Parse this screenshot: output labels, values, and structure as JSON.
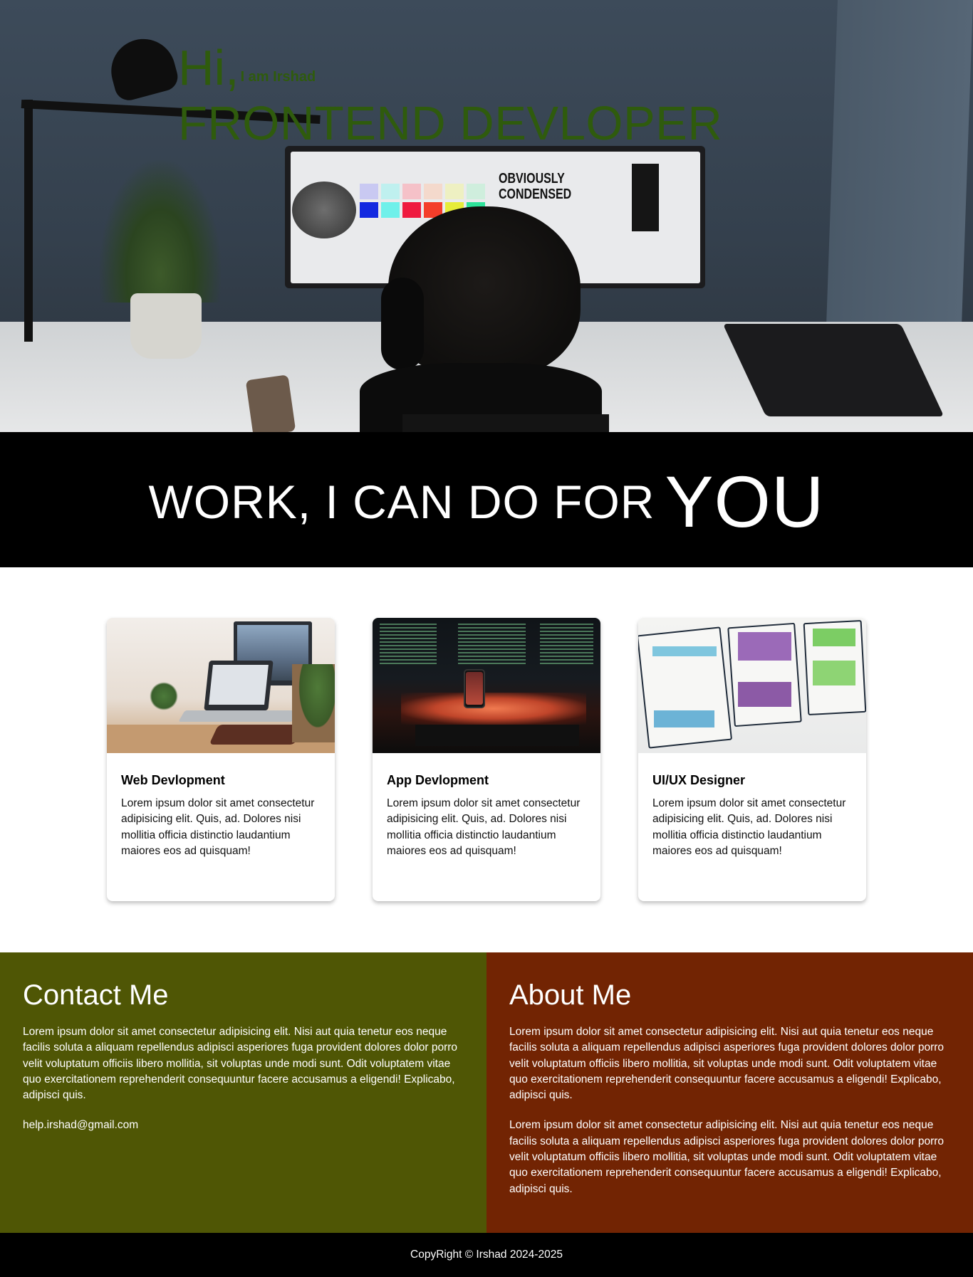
{
  "hero": {
    "greeting": "Hi,",
    "name": "I am Irshad",
    "role": "FRONTEND DEVLOPER",
    "text_color": "#2f5b0d",
    "screen_text_line1": "OBVIOUSLY",
    "screen_text_line2": "CONDENSED"
  },
  "banner": {
    "text": "WORK, I CAN DO FOR",
    "emphasis": "YOU",
    "background": "#000000"
  },
  "services": [
    {
      "title": "Web Devlopment",
      "text": "Lorem ipsum dolor sit amet consectetur adipisicing elit. Quis, ad. Dolores nisi mollitia officia distinctio laudantium maiores eos ad quisquam!",
      "image": "workspace-laptop-photo"
    },
    {
      "title": "App Devlopment",
      "text": "Lorem ipsum dolor sit amet consectetur adipisicing elit. Quis, ad. Dolores nisi mollitia officia distinctio laudantium maiores eos ad quisquam!",
      "image": "code-monitors-phone-photo"
    },
    {
      "title": "UI/UX Designer",
      "text": "Lorem ipsum dolor sit amet consectetur adipisicing elit. Quis, ad. Dolores nisi mollitia officia distinctio laudantium maiores eos ad quisquam!",
      "image": "wireframe-sketch-photo"
    }
  ],
  "contact": {
    "title": "Contact Me",
    "text": "Lorem ipsum dolor sit amet consectetur adipisicing elit. Nisi aut quia tenetur eos neque facilis soluta a aliquam repellendus adipisci asperiores fuga provident dolores dolor porro velit voluptatum officiis libero mollitia, sit voluptas unde modi sunt. Odit voluptatem vitae quo exercitationem reprehenderit consequuntur facere accusamus a eligendi! Explicabo, adipisci quis.",
    "email": "help.irshad@gmail.com",
    "background": "#4f5605"
  },
  "about": {
    "title": "About Me",
    "paragraphs": [
      "Lorem ipsum dolor sit amet consectetur adipisicing elit. Nisi aut quia tenetur eos neque facilis soluta a aliquam repellendus adipisci asperiores fuga provident dolores dolor porro velit voluptatum officiis libero mollitia, sit voluptas unde modi sunt. Odit voluptatem vitae quo exercitationem reprehenderit consequuntur facere accusamus a eligendi! Explicabo, adipisci quis.",
      "Lorem ipsum dolor sit amet consectetur adipisicing elit. Nisi aut quia tenetur eos neque facilis soluta a aliquam repellendus adipisci asperiores fuga provident dolores dolor porro velit voluptatum officiis libero mollitia, sit voluptas unde modi sunt. Odit voluptatem vitae quo exercitationem reprehenderit consequuntur facere accusamus a eligendi! Explicabo, adipisci quis."
    ],
    "background": "#722403"
  },
  "footer": {
    "text": "CopyRight © Irshad 2024-2025"
  }
}
